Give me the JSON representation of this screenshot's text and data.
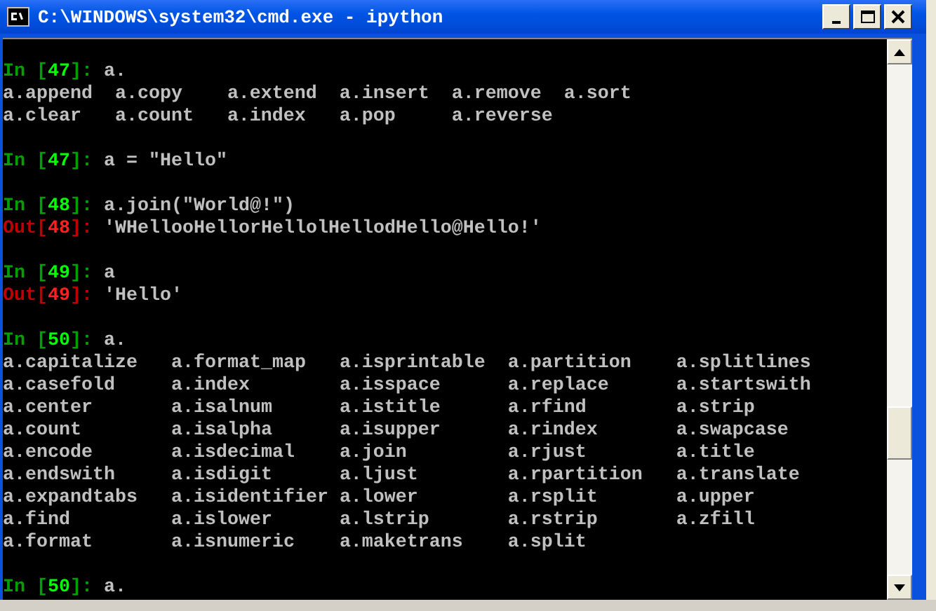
{
  "window": {
    "title": "C:\\WINDOWS\\system32\\cmd.exe - ipython"
  },
  "console": {
    "lines": [
      {
        "kind": "in",
        "prefix": "In [",
        "number": "47",
        "suffix": "]:",
        "text": "a."
      },
      {
        "kind": "completions",
        "rows": [
          [
            "a.append",
            "a.copy",
            "a.extend",
            "a.insert",
            "a.remove",
            "a.sort"
          ],
          [
            "a.clear",
            "a.count",
            "a.index",
            "a.pop",
            "a.reverse"
          ]
        ]
      },
      {
        "kind": "blank"
      },
      {
        "kind": "in",
        "prefix": "In [",
        "number": "47",
        "suffix": "]:",
        "text": "a = \"Hello\""
      },
      {
        "kind": "blank"
      },
      {
        "kind": "in",
        "prefix": "In [",
        "number": "48",
        "suffix": "]:",
        "text": "a.join(\"World@!\")"
      },
      {
        "kind": "out",
        "prefix": "Out[",
        "number": "48",
        "suffix": "]:",
        "text": "'WHellooHellorHellolHellodHello@Hello!'"
      },
      {
        "kind": "blank"
      },
      {
        "kind": "in",
        "prefix": "In [",
        "number": "49",
        "suffix": "]:",
        "text": "a"
      },
      {
        "kind": "out",
        "prefix": "Out[",
        "number": "49",
        "suffix": "]:",
        "text": "'Hello'"
      },
      {
        "kind": "blank"
      },
      {
        "kind": "in",
        "prefix": "In [",
        "number": "50",
        "suffix": "]:",
        "text": "a."
      },
      {
        "kind": "completions",
        "rows": [
          [
            "a.capitalize",
            "a.format_map",
            "a.isprintable",
            "a.partition",
            "a.splitlines"
          ],
          [
            "a.casefold",
            "a.index",
            "a.isspace",
            "a.replace",
            "a.startswith"
          ],
          [
            "a.center",
            "a.isalnum",
            "a.istitle",
            "a.rfind",
            "a.strip"
          ],
          [
            "a.count",
            "a.isalpha",
            "a.isupper",
            "a.rindex",
            "a.swapcase"
          ],
          [
            "a.encode",
            "a.isdecimal",
            "a.join",
            "a.rjust",
            "a.title"
          ],
          [
            "a.endswith",
            "a.isdigit",
            "a.ljust",
            "a.rpartition",
            "a.translate"
          ],
          [
            "a.expandtabs",
            "a.isidentifier",
            "a.lower",
            "a.rsplit",
            "a.upper"
          ],
          [
            "a.find",
            "a.islower",
            "a.lstrip",
            "a.rstrip",
            "a.zfill"
          ],
          [
            "a.format",
            "a.isnumeric",
            "a.maketrans",
            "a.split"
          ]
        ]
      },
      {
        "kind": "blank"
      },
      {
        "kind": "in",
        "prefix": "In [",
        "number": "50",
        "suffix": "]:",
        "text": "a."
      }
    ]
  }
}
